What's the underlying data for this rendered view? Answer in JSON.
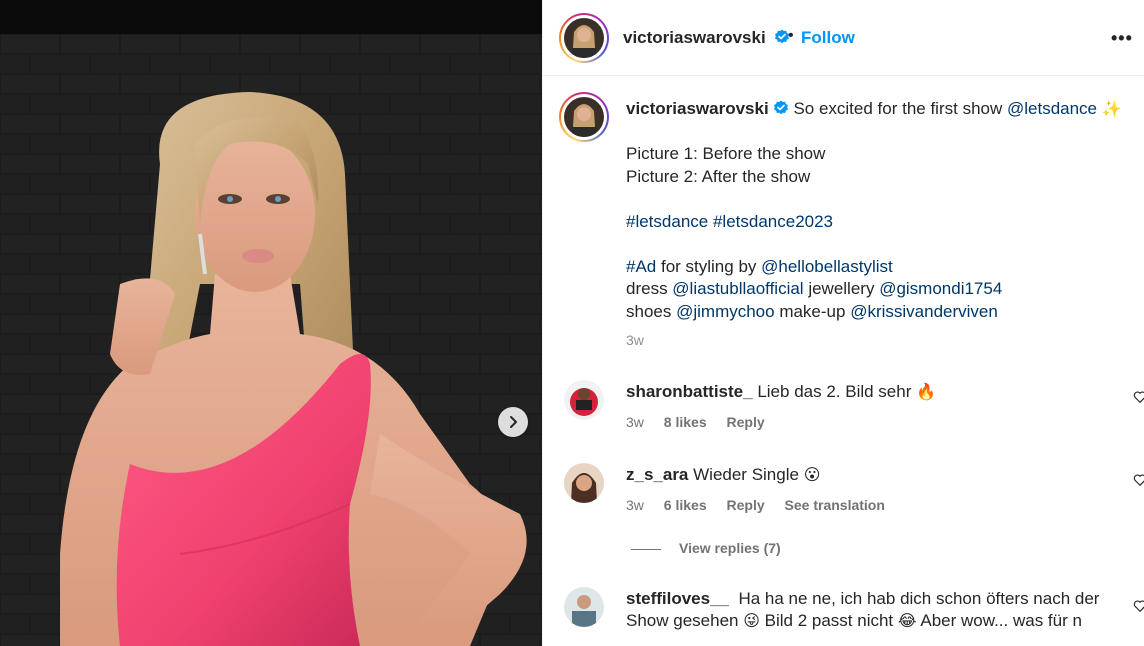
{
  "post": {
    "username": "victoriaswarovski",
    "follow_label": "Follow",
    "more_label": "•••",
    "dot": "•"
  },
  "caption": {
    "username": "victoriaswarovski",
    "line1_text": "So excited for the first show ",
    "line1_mention": "@letsdance",
    "line1_emoji": "✨",
    "picture1": "Picture 1: Before the show",
    "picture2": "Picture 2: After the show",
    "hashtag1": "#letsdance",
    "hashtag2": "#letsdance2023",
    "ad_tag": "#Ad",
    "styling_text": " for styling by ",
    "styling_mention": "@hellobellastylist",
    "dress_text": "dress ",
    "dress_mention": "@liastubllaofficial",
    "jewellery_text": " jewellery ",
    "jewellery_mention": "@gismondi1754",
    "shoes_text": "shoes ",
    "shoes_mention": "@jimmychoo",
    "makeup_text": " make-up ",
    "makeup_mention": "@krissivanderviven",
    "time": "3w"
  },
  "comments": [
    {
      "username": "sharonbattiste_",
      "text": "Lieb das 2. Bild sehr",
      "emoji": "🔥",
      "time": "3w",
      "likes": "8 likes",
      "reply": "Reply"
    },
    {
      "username": "z_s_ara",
      "text": "Wieder Single",
      "emoji": "😮",
      "time": "3w",
      "likes": "6 likes",
      "reply": "Reply",
      "translate": "See translation",
      "view_replies": "View replies (7)"
    },
    {
      "username": "steffiloves__",
      "text_line1": "Ha ha ne ne, ich hab dich schon öfters nach der",
      "text_line2_a": "Show gesehen",
      "emoji_a": "😜",
      "text_line2_b": " Bild 2 passt nicht ",
      "emoji_b": "😂",
      "text_line2_c": " Aber wow... was für n"
    }
  ],
  "colors": {
    "accent": "#0095f6",
    "link": "#00376b",
    "dress": "#f0416f",
    "verified": "#0095f6"
  },
  "icons": [
    "verified-badge-icon",
    "chevron-right-icon",
    "heart-icon",
    "more-options-icon"
  ]
}
